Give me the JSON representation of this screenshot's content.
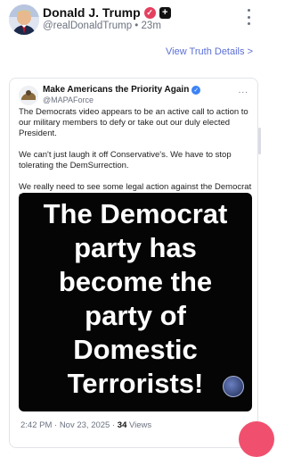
{
  "post": {
    "author_name": "Donald J. Trump",
    "author_handle": "@realDonaldTrump",
    "separator": "•",
    "time_ago": "23m",
    "view_details": "View Truth Details",
    "view_details_chevron": ">"
  },
  "quoted": {
    "author_name": "Make Americans the Priority Again",
    "author_handle": "@MAPAForce",
    "more": "...",
    "paragraphs": [
      "The Democrats video appears to be an active call to action to our military members to defy or take out our duly elected President.",
      "We can't just laugh it off Conservative's. We have to stop tolerating the DemSurrection.",
      "We really need to see some legal action against the Democrat Domestic Terrorist party"
    ],
    "image_text_lines": [
      "The Democrat",
      "party has",
      "become the",
      "party of",
      "Domestic",
      "Terrorists!"
    ],
    "timestamp": "2:42 PM · Nov 23, 2025 · ",
    "views_count": "34",
    "views_label": " Views"
  },
  "colors": {
    "verified_badge": "#e4405f",
    "quoted_verified": "#3b82f6",
    "link": "#5b6fd6",
    "fab": "#f0506e"
  },
  "icons": {
    "verified": "verified-badge-icon",
    "plus": "plus-badge-icon",
    "more": "more-vertical-icon"
  }
}
